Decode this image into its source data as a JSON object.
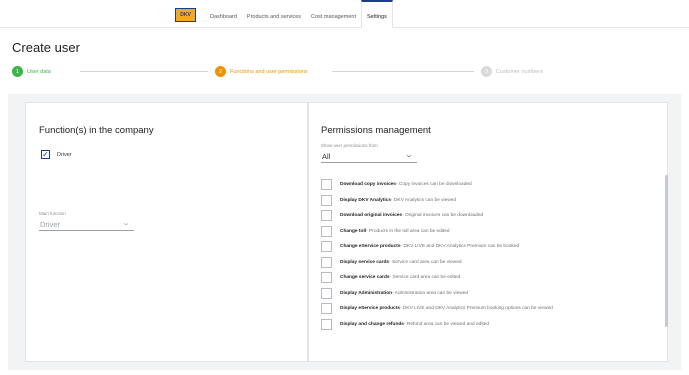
{
  "header": {
    "logo_text": "DKV",
    "nav_tabs": [
      {
        "label": "Dashboard",
        "active": false
      },
      {
        "label": "Products and services",
        "active": false
      },
      {
        "label": "Cost management",
        "active": false
      },
      {
        "label": "Settings",
        "active": true
      }
    ]
  },
  "page_title": "Create user",
  "stepper": {
    "steps": [
      {
        "number": "1",
        "label": "User data",
        "state": "completed"
      },
      {
        "number": "2",
        "label": "Functions and user permissions",
        "state": "active"
      },
      {
        "number": "3",
        "label": "Customer numbers",
        "state": "inactive"
      }
    ]
  },
  "functions": {
    "title": "Function(s) in the company",
    "checkbox_driver": {
      "label": "Driver",
      "checked": true
    },
    "main_function": {
      "label": "Main function",
      "value": "Driver"
    }
  },
  "permissions": {
    "title": "Permissions management",
    "filter": {
      "label": "Show user permissions from",
      "value": "All"
    },
    "items": [
      {
        "name": "Download copy invoices",
        "desc": " - Copy invoices can be downloaded"
      },
      {
        "name": "Display DKV Analytics",
        "desc": " - DKV Analytics can be viewed"
      },
      {
        "name": "Download original invoices",
        "desc": " - Original invoices can be downloaded"
      },
      {
        "name": "Change toll",
        "desc": " - Products in the toll area can be edited"
      },
      {
        "name": "Change eService products",
        "desc": " - DKV LIVE and DKV Analytics Premium can be booked"
      },
      {
        "name": "Display service cards",
        "desc": " - Service card area can be viewed"
      },
      {
        "name": "Change service cards",
        "desc": " - Service card area can be edited"
      },
      {
        "name": "Display Administration",
        "desc": " - Administration area can be viewed"
      },
      {
        "name": "Display eService products",
        "desc": " - DKV LIVE and DKV Analytics Premium booking options can be viewed"
      },
      {
        "name": "Display and change refunds",
        "desc": " - Refund area can be viewed and edited"
      }
    ]
  },
  "colors": {
    "accent_orange": "#f39200",
    "success_green": "#3cb44a",
    "brand_blue": "#1d3c8f",
    "inactive_gray": "#d9d9d9"
  }
}
